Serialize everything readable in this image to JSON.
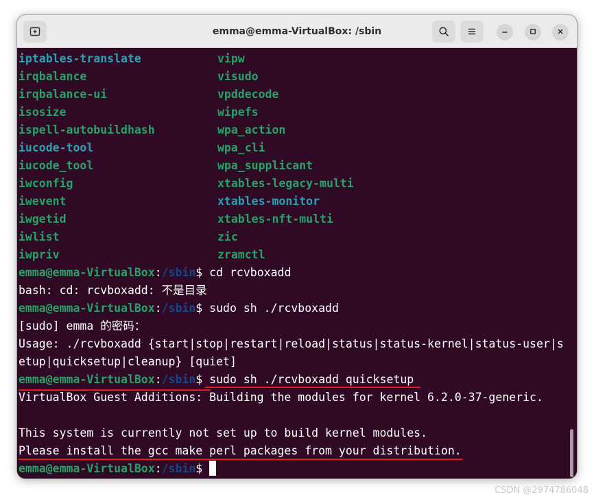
{
  "window": {
    "title": "emma@emma-VirtualBox: /sbin"
  },
  "titlebar": {
    "new_tab_icon": "new-tab-icon",
    "search_icon": "search-icon",
    "menu_icon": "hamburger-menu-icon",
    "minimize_icon": "minimize-icon",
    "maximize_icon": "maximize-icon",
    "close_icon": "close-icon"
  },
  "colors": {
    "terminal_bg": "#300a24",
    "prompt_user": "#26a269",
    "prompt_path": "#12488b",
    "file_green": "#26a269",
    "file_blue": "#2aa1b3",
    "annotation_red": "#e01b24"
  },
  "listing": [
    {
      "left": "iptables-translate",
      "left_color": "blue",
      "right": "vipw",
      "right_color": "green"
    },
    {
      "left": "irqbalance",
      "left_color": "green",
      "right": "visudo",
      "right_color": "green"
    },
    {
      "left": "irqbalance-ui",
      "left_color": "green",
      "right": "vpddecode",
      "right_color": "green"
    },
    {
      "left": "isosize",
      "left_color": "green",
      "right": "wipefs",
      "right_color": "green"
    },
    {
      "left": "ispell-autobuildhash",
      "left_color": "green",
      "right": "wpa_action",
      "right_color": "green"
    },
    {
      "left": "iucode-tool",
      "left_color": "blue",
      "right": "wpa_cli",
      "right_color": "green"
    },
    {
      "left": "iucode_tool",
      "left_color": "green",
      "right": "wpa_supplicant",
      "right_color": "green"
    },
    {
      "left": "iwconfig",
      "left_color": "green",
      "right": "xtables-legacy-multi",
      "right_color": "green"
    },
    {
      "left": "iwevent",
      "left_color": "green",
      "right": "xtables-monitor",
      "right_color": "blue"
    },
    {
      "left": "iwgetid",
      "left_color": "green",
      "right": "xtables-nft-multi",
      "right_color": "green"
    },
    {
      "left": "iwlist",
      "left_color": "green",
      "right": "zic",
      "right_color": "green"
    },
    {
      "left": "iwpriv",
      "left_color": "green",
      "right": "zramctl",
      "right_color": "green"
    }
  ],
  "prompt": {
    "user": "emma@emma-VirtualBox",
    "colon": ":",
    "path": "/sbin",
    "dollar": "$"
  },
  "session": {
    "cmd1": " cd rcvboxadd",
    "out1": "bash: cd: rcvboxadd: 不是目录",
    "cmd2": " sudo sh ./rcvboxadd",
    "out2a": "[sudo] emma 的密码：",
    "out2b": "Usage: ./rcvboxadd {start|stop|restart|reload|status|status-kernel|status-user|s",
    "out2c": "etup|quicksetup|cleanup} [quiet]",
    "cmd3": " sudo sh ./rcvboxadd quicksetup",
    "out3a": "VirtualBox Guest Additions: Building the modules for kernel 6.2.0-37-generic.",
    "out3b": "",
    "out3c": "This system is currently not set up to build kernel modules.",
    "out3d": "Please install the gcc make perl packages from your distribution."
  },
  "watermark": "CSDN @2974786048"
}
